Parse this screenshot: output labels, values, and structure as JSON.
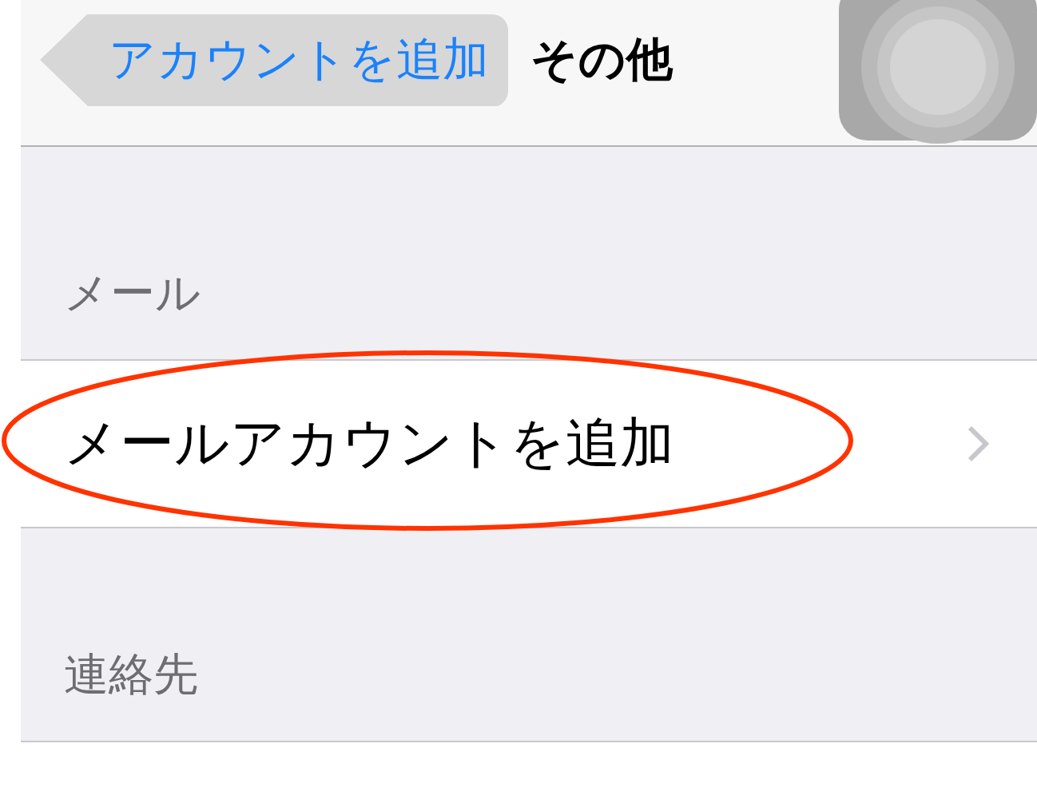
{
  "nav_bar": {
    "back_button": {
      "label": "アカウントを追加",
      "pressed": true
    },
    "title": "その他"
  },
  "sections": [
    {
      "header": "メール",
      "items": [
        {
          "label": "メールアカウントを追加",
          "highlighted": true
        }
      ]
    },
    {
      "header": "連絡先"
    }
  ]
}
